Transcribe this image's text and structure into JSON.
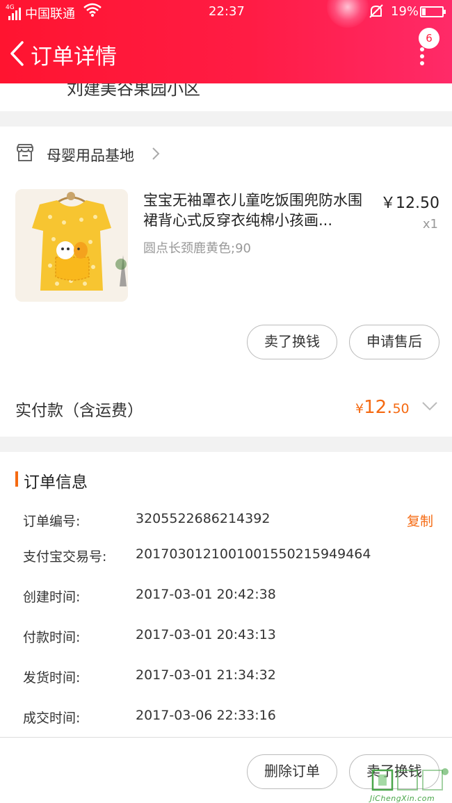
{
  "status_bar": {
    "network": "4G",
    "carrier": "中国联通",
    "time": "22:37",
    "battery": "19%",
    "battery_level": 0.19
  },
  "header": {
    "title": "订单详情",
    "badge_count": "6"
  },
  "address_partial": "刘建美谷果园小区",
  "shop": {
    "name": "母婴用品基地"
  },
  "product": {
    "title": "宝宝无袖罩衣儿童吃饭围兜防水围裙背心式反穿衣纯棉小孩画...",
    "price": "￥12.50",
    "qty": "x1",
    "spec": "圆点长颈鹿黄色;90"
  },
  "actions": {
    "sell_label": "卖了换钱",
    "after_sale_label": "申请售后"
  },
  "payment": {
    "label": "实付款（含运费）",
    "currency": "¥",
    "amount_int": "12.",
    "amount_dec": "50"
  },
  "order_info": {
    "title": "订单信息",
    "copy_label": "复制",
    "rows": [
      {
        "key": "订单编号:",
        "value": "3205522686214392"
      },
      {
        "key": "支付宝交易号:",
        "value": "2017030121001001550215949464"
      },
      {
        "key": "创建时间:",
        "value": "2017-03-01 20:42:38"
      },
      {
        "key": "付款时间:",
        "value": "2017-03-01 20:43:13"
      },
      {
        "key": "发货时间:",
        "value": "2017-03-01 21:34:32"
      },
      {
        "key": "成交时间:",
        "value": "2017-03-06 22:33:16"
      }
    ]
  },
  "bottom_bar": {
    "delete_label": "删除订单",
    "sell_label": "卖了换钱"
  },
  "watermark": {
    "text": "JiChengXin.com"
  },
  "colors": {
    "header_red": "#ff1c44",
    "accent_orange": "#f56a12"
  }
}
